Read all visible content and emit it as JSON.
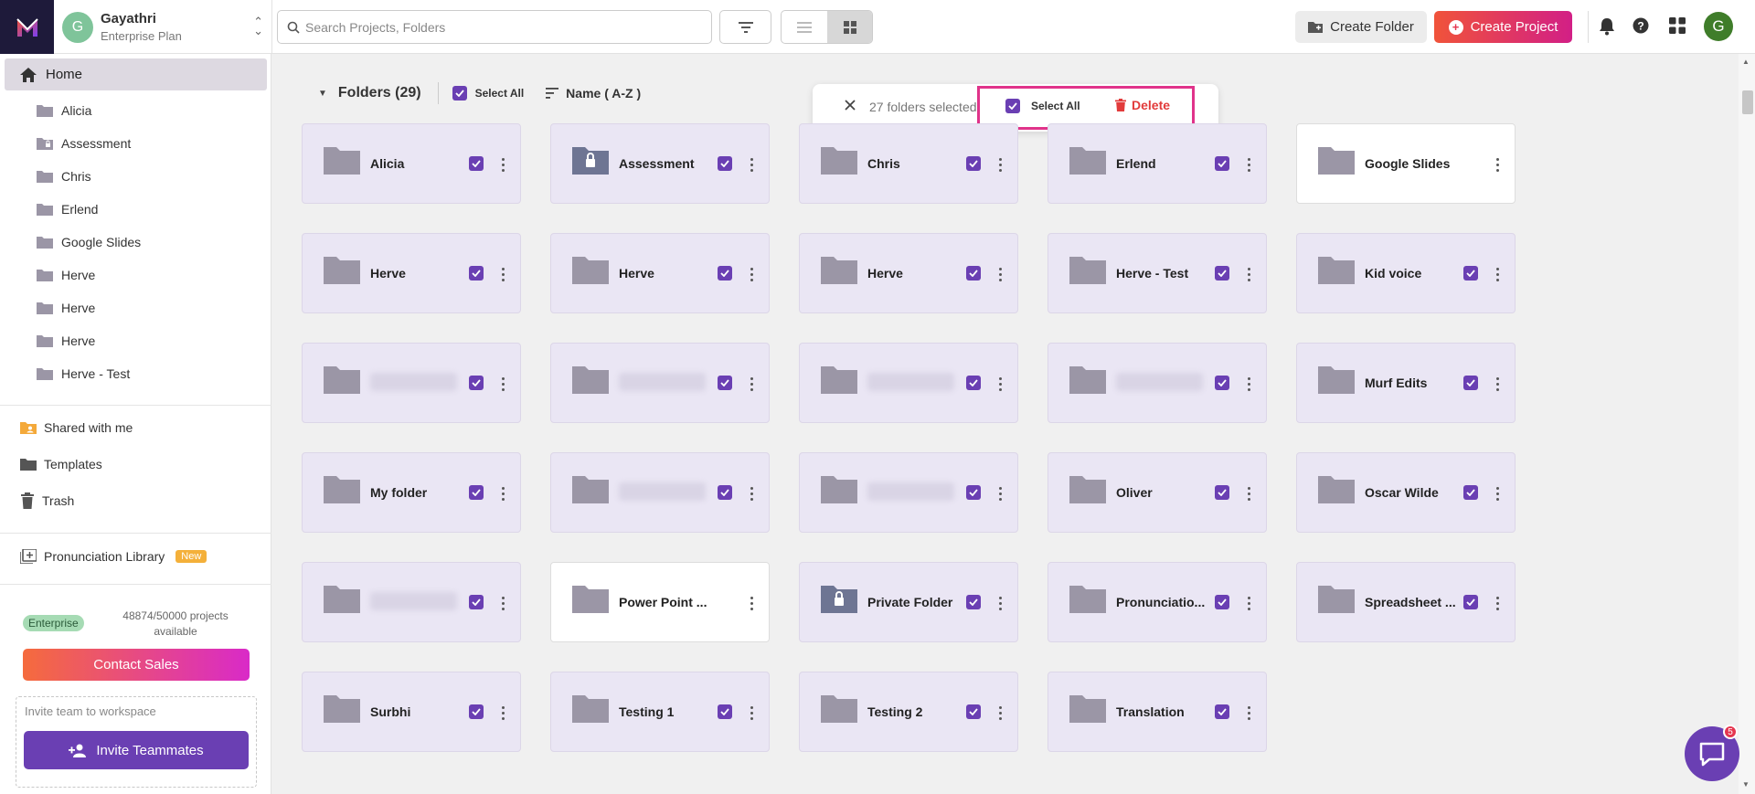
{
  "workspace": {
    "initial": "G",
    "name": "Gayathri",
    "plan": "Enterprise Plan"
  },
  "search": {
    "placeholder": "Search Projects, Folders",
    "value": ""
  },
  "toolbar": {
    "create_folder": "Create Folder",
    "create_project": "Create Project"
  },
  "user": {
    "initial": "G"
  },
  "sidebar": {
    "home": "Home",
    "tree": [
      "Alicia",
      "Assessment",
      "Chris",
      "Erlend",
      "Google Slides",
      "Herve",
      "Herve",
      "Herve",
      "Herve - Test"
    ],
    "shared": "Shared with me",
    "templates": "Templates",
    "trash": "Trash",
    "pronunciation": "Pronunciation Library",
    "new_badge": "New",
    "plan_badge": "Enterprise",
    "projects_count": "48874/50000 projects available",
    "contact_sales": "Contact Sales",
    "invite_label": "Invite team to workspace",
    "invite_button": "Invite Teammates"
  },
  "folders_header": {
    "title": "Folders (29)",
    "select_all": "Select All",
    "sort": "Name ( A-Z )"
  },
  "selection_bar": {
    "count": "27 folders selected",
    "select_all": "Select All",
    "delete": "Delete"
  },
  "folders": [
    {
      "name": "Alicia",
      "checked": true,
      "locked": false,
      "blur": false
    },
    {
      "name": "Assessment",
      "checked": true,
      "locked": true,
      "blur": false
    },
    {
      "name": "Chris",
      "checked": true,
      "locked": false,
      "blur": false
    },
    {
      "name": "Erlend",
      "checked": true,
      "locked": false,
      "blur": false
    },
    {
      "name": "Google Slides",
      "checked": false,
      "locked": false,
      "blur": false
    },
    {
      "name": "Herve",
      "checked": true,
      "locked": false,
      "blur": false
    },
    {
      "name": "Herve",
      "checked": true,
      "locked": false,
      "blur": false
    },
    {
      "name": "Herve",
      "checked": true,
      "locked": false,
      "blur": false
    },
    {
      "name": "Herve - Test",
      "checked": true,
      "locked": false,
      "blur": false
    },
    {
      "name": "Kid voice",
      "checked": true,
      "locked": false,
      "blur": false
    },
    {
      "name": "",
      "checked": true,
      "locked": false,
      "blur": true
    },
    {
      "name": "",
      "checked": true,
      "locked": false,
      "blur": true
    },
    {
      "name": "",
      "checked": true,
      "locked": false,
      "blur": true
    },
    {
      "name": "",
      "checked": true,
      "locked": false,
      "blur": true
    },
    {
      "name": "Murf Edits",
      "checked": true,
      "locked": false,
      "blur": false
    },
    {
      "name": "My folder",
      "checked": true,
      "locked": false,
      "blur": false
    },
    {
      "name": "",
      "checked": true,
      "locked": false,
      "blur": true
    },
    {
      "name": "",
      "checked": true,
      "locked": false,
      "blur": true
    },
    {
      "name": "Oliver",
      "checked": true,
      "locked": false,
      "blur": false
    },
    {
      "name": "Oscar Wilde",
      "checked": true,
      "locked": false,
      "blur": false
    },
    {
      "name": "",
      "checked": true,
      "locked": false,
      "blur": true
    },
    {
      "name": "Power Point ...",
      "checked": false,
      "locked": false,
      "blur": false
    },
    {
      "name": "Private Folder",
      "checked": true,
      "locked": true,
      "blur": false
    },
    {
      "name": "Pronunciatio...",
      "checked": true,
      "locked": false,
      "blur": false
    },
    {
      "name": "Spreadsheet ...",
      "checked": true,
      "locked": false,
      "blur": false
    },
    {
      "name": "Surbhi",
      "checked": true,
      "locked": false,
      "blur": false
    },
    {
      "name": "Testing 1",
      "checked": true,
      "locked": false,
      "blur": false
    },
    {
      "name": "Testing 2",
      "checked": true,
      "locked": false,
      "blur": false
    },
    {
      "name": "Translation",
      "checked": true,
      "locked": false,
      "blur": false
    }
  ],
  "chat": {
    "badge": "5"
  },
  "colors": {
    "accent": "#6a3fb3",
    "delete": "#e23b3b",
    "highlight": "#e0338a",
    "folder": "#9b96a6"
  }
}
